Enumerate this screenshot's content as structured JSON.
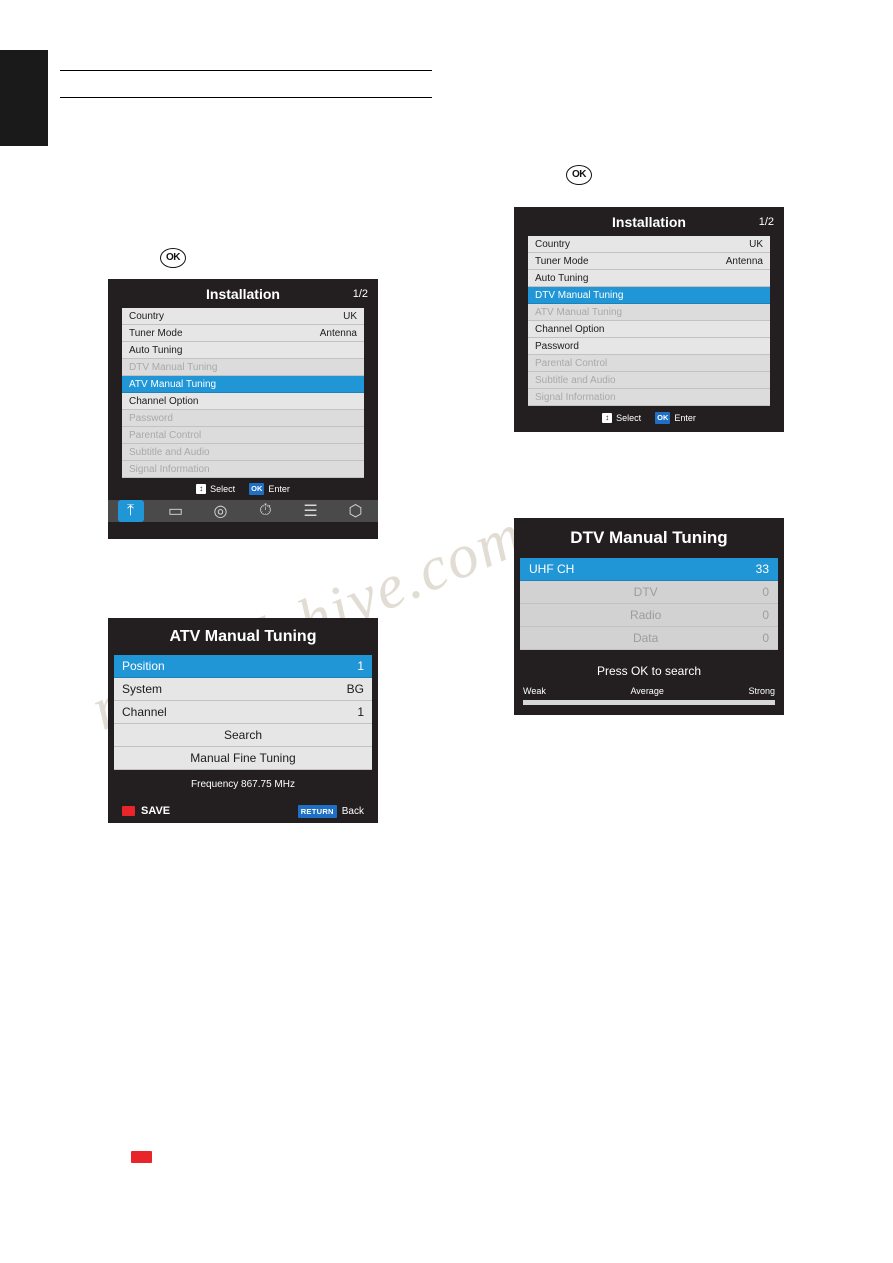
{
  "page": {
    "watermark_line1": "manualshive.com",
    "watermark_line2": ""
  },
  "ok_key_label": "OK",
  "installation_1": {
    "title": "Installation",
    "page_indicator": "1/2",
    "rows": [
      {
        "label": "Country",
        "value": "UK",
        "state": "normal"
      },
      {
        "label": "Tuner Mode",
        "value": "Antenna",
        "state": "normal"
      },
      {
        "label": "Auto Tuning",
        "value": "",
        "state": "normal"
      },
      {
        "label": "DTV Manual Tuning",
        "value": "",
        "state": "dim"
      },
      {
        "label": "ATV Manual Tuning",
        "value": "",
        "state": "selected"
      },
      {
        "label": "Channel Option",
        "value": "",
        "state": "normal"
      },
      {
        "label": "Password",
        "value": "",
        "state": "dim"
      },
      {
        "label": "Parental Control",
        "value": "",
        "state": "dim"
      },
      {
        "label": "Subtitle and Audio",
        "value": "",
        "state": "dim"
      },
      {
        "label": "Signal Information",
        "value": "",
        "state": "dim"
      }
    ],
    "hints": [
      {
        "key": "updown",
        "key_label": "↕",
        "text": "Select"
      },
      {
        "key": "ok",
        "key_label": "OK",
        "text": "Enter"
      }
    ],
    "icon_strip": [
      {
        "name": "installation-icon",
        "glyph": "⤒",
        "active": true
      },
      {
        "name": "picture-icon",
        "glyph": "▭",
        "active": false
      },
      {
        "name": "sound-icon",
        "glyph": "◎",
        "active": false
      },
      {
        "name": "timer-icon",
        "glyph": "⏱",
        "active": false
      },
      {
        "name": "options-icon",
        "glyph": "☰",
        "active": false
      },
      {
        "name": "lock-icon",
        "glyph": "⬡",
        "active": false
      }
    ]
  },
  "atv_manual_tuning": {
    "title": "ATV Manual Tuning",
    "rows": [
      {
        "label": "Position",
        "value": "1",
        "state": "selected"
      },
      {
        "label": "System",
        "value": "BG",
        "state": "normal"
      },
      {
        "label": "Channel",
        "value": "1",
        "state": "normal"
      },
      {
        "label": "Search",
        "value": "",
        "state": "center"
      },
      {
        "label": "Manual Fine Tuning",
        "value": "",
        "state": "center"
      }
    ],
    "frequency": "Frequency 867.75 MHz",
    "save_label": "SAVE",
    "return_chip": "RETURN",
    "back_label": "Back"
  },
  "installation_2": {
    "title": "Installation",
    "page_indicator": "1/2",
    "rows": [
      {
        "label": "Country",
        "value": "UK",
        "state": "normal"
      },
      {
        "label": "Tuner Mode",
        "value": "Antenna",
        "state": "normal"
      },
      {
        "label": "Auto Tuning",
        "value": "",
        "state": "normal"
      },
      {
        "label": "DTV Manual Tuning",
        "value": "",
        "state": "selected"
      },
      {
        "label": "ATV Manual Tuning",
        "value": "",
        "state": "dim"
      },
      {
        "label": "Channel Option",
        "value": "",
        "state": "normal"
      },
      {
        "label": "Password",
        "value": "",
        "state": "normal"
      },
      {
        "label": "Parental Control",
        "value": "",
        "state": "dim"
      },
      {
        "label": "Subtitle and Audio",
        "value": "",
        "state": "dim"
      },
      {
        "label": "Signal Information",
        "value": "",
        "state": "dim"
      }
    ],
    "hints": [
      {
        "key": "updown",
        "key_label": "↕",
        "text": "Select"
      },
      {
        "key": "ok",
        "key_label": "OK",
        "text": "Enter"
      }
    ]
  },
  "dtv_manual_tuning": {
    "title": "DTV Manual Tuning",
    "rows": [
      {
        "label": "UHF CH",
        "value": "33",
        "state": "selected"
      },
      {
        "label": "DTV",
        "value": "0",
        "state": "dim"
      },
      {
        "label": "Radio",
        "value": "0",
        "state": "dim"
      },
      {
        "label": "Data",
        "value": "0",
        "state": "dim"
      }
    ],
    "press_ok": "Press OK to search",
    "signal": {
      "weak": "Weak",
      "average": "Average",
      "strong": "Strong"
    }
  }
}
